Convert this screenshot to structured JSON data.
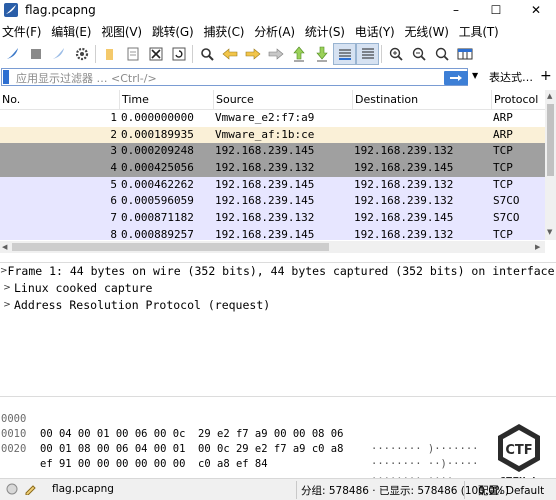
{
  "window": {
    "title": "flag.pcapng",
    "controls": [
      "–",
      "☐",
      "✕"
    ]
  },
  "menu": [
    "文件(F)",
    "编辑(E)",
    "视图(V)",
    "跳转(G)",
    "捕获(C)",
    "分析(A)",
    "统计(S)",
    "电话(Y)",
    "无线(W)",
    "工具(T)"
  ],
  "filter": {
    "placeholder": "应用显示过滤器 … <Ctrl-/>",
    "expression_label": "表达式…",
    "add_label": "+"
  },
  "packet_list": {
    "columns": [
      "No.",
      "Time",
      "Source",
      "Destination",
      "Protocol"
    ],
    "rows": [
      {
        "no": "1",
        "time": "0.000000000",
        "source": "Vmware_e2:f7:a9",
        "destination": "",
        "protocol": "ARP",
        "bg": "#ffffff",
        "fg": "#000000"
      },
      {
        "no": "2",
        "time": "0.000189935",
        "source": "Vmware_af:1b:ce",
        "destination": "",
        "protocol": "ARP",
        "bg": "#faf0d7",
        "fg": "#000000"
      },
      {
        "no": "3",
        "time": "0.000209248",
        "source": "192.168.239.145",
        "destination": "192.168.239.132",
        "protocol": "TCP",
        "bg": "#a0a0a0",
        "fg": "#000000"
      },
      {
        "no": "4",
        "time": "0.000425056",
        "source": "192.168.239.132",
        "destination": "192.168.239.145",
        "protocol": "TCP",
        "bg": "#a0a0a0",
        "fg": "#000000"
      },
      {
        "no": "5",
        "time": "0.000462262",
        "source": "192.168.239.145",
        "destination": "192.168.239.132",
        "protocol": "TCP",
        "bg": "#e7e6ff",
        "fg": "#000000"
      },
      {
        "no": "6",
        "time": "0.000596059",
        "source": "192.168.239.145",
        "destination": "192.168.239.132",
        "protocol": "S7CO",
        "bg": "#e7e6ff",
        "fg": "#000000"
      },
      {
        "no": "7",
        "time": "0.000871182",
        "source": "192.168.239.132",
        "destination": "192.168.239.145",
        "protocol": "S7CO",
        "bg": "#e7e6ff",
        "fg": "#000000"
      },
      {
        "no": "8",
        "time": "0.000889257",
        "source": "192.168.239.145",
        "destination": "192.168.239.132",
        "protocol": "TCP",
        "bg": "#e7e6ff",
        "fg": "#000000"
      }
    ]
  },
  "details": [
    "Frame 1: 44 bytes on wire (352 bits), 44 bytes captured (352 bits) on interface 0",
    "Linux cooked capture",
    "Address Resolution Protocol (request)"
  ],
  "bytes": [
    {
      "offset": "0000",
      "hex": "00 04 00 01 00 06 00 0c  29 e2 f7 a9 00 00 08 06",
      "ascii": "········ )·······"
    },
    {
      "offset": "0010",
      "hex": "00 01 08 00 06 04 00 01  00 0c 29 e2 f7 a9 c0 a8",
      "ascii": "········ ··)·····"
    },
    {
      "offset": "0020",
      "hex": "ef 91 00 00 00 00 00 00  c0 a8 ef 84",
      "ascii": "········ ····"
    }
  ],
  "logo": {
    "text": "CTFHub"
  },
  "status": {
    "file": "flag.pcapng",
    "packets": "分组: 578486 · 已显示: 578486 (100.0%)",
    "profile": "配置: Default"
  },
  "colors": {
    "selected_blue": "#2d6fd1",
    "arp_white": "#ffffff",
    "arp_tan": "#faf0d7",
    "tcp_gray": "#a0a0a0",
    "tcp_lavender": "#e7e6ff"
  }
}
